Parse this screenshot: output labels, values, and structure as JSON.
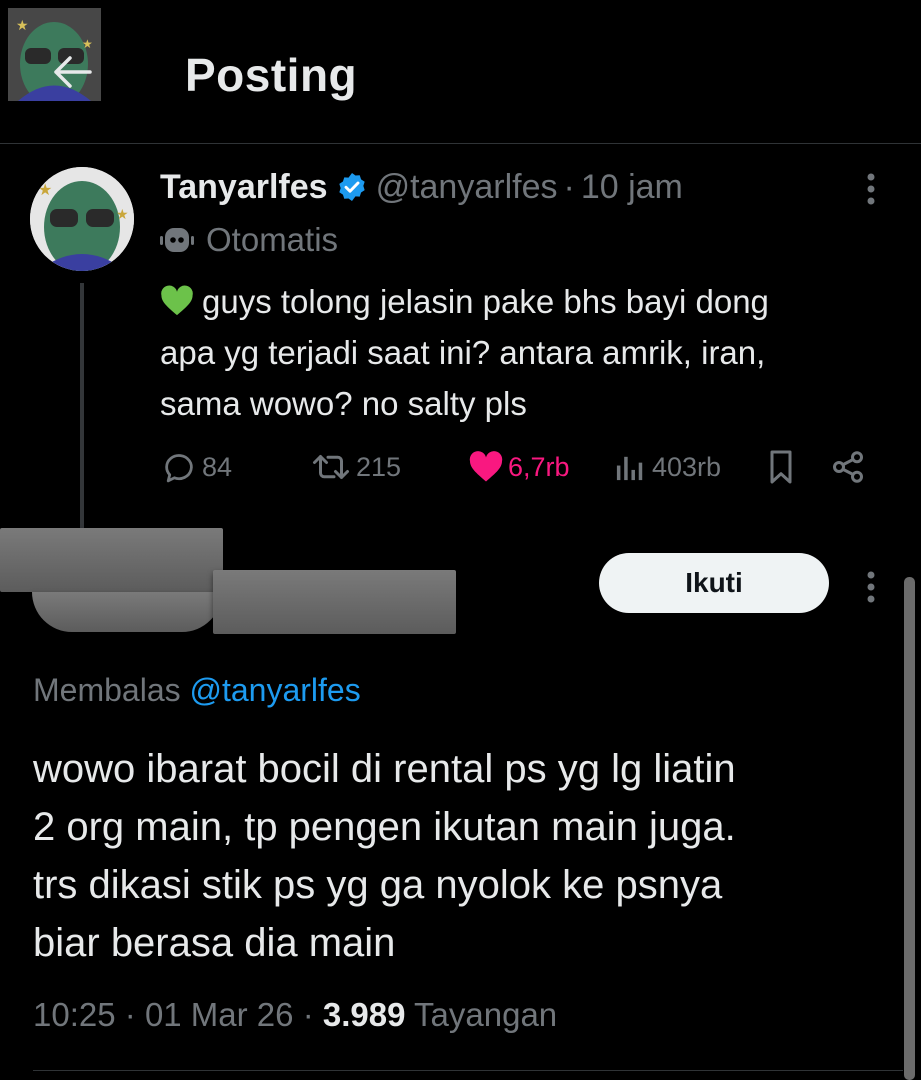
{
  "header": {
    "title": "Posting"
  },
  "tweet": {
    "author_name": "Tanyarlfes",
    "handle": "@tanyarlfes",
    "separator": "·",
    "time": "10 jam",
    "automated_label": "Otomatis",
    "text_lines": [
      "guys tolong jelasin pake bhs bayi dong",
      "apa yg terjadi saat ini? antara amrik, iran,",
      "sama wowo? no salty pls"
    ],
    "stats": {
      "replies": "84",
      "reposts": "215",
      "likes": "6,7rb",
      "views": "403rb"
    }
  },
  "reply": {
    "follow_label": "Ikuti",
    "replying_prefix": "Membalas",
    "replying_to": "@tanyarlfes",
    "text_lines": [
      "wowo ibarat bocil di rental ps yg lg liatin",
      "2 org main, tp pengen ikutan main juga.",
      "trs dikasi stik ps yg ga nyolok ke psnya",
      "biar berasa dia main"
    ],
    "time": "10:25",
    "separator": "·",
    "date": "01 Mar 26",
    "views_count": "3.989",
    "views_label": "Tayangan"
  },
  "colors": {
    "like": "#f91880",
    "link": "#1d9bf0",
    "verified": "#1d9bf0",
    "muted": "#71767b"
  }
}
